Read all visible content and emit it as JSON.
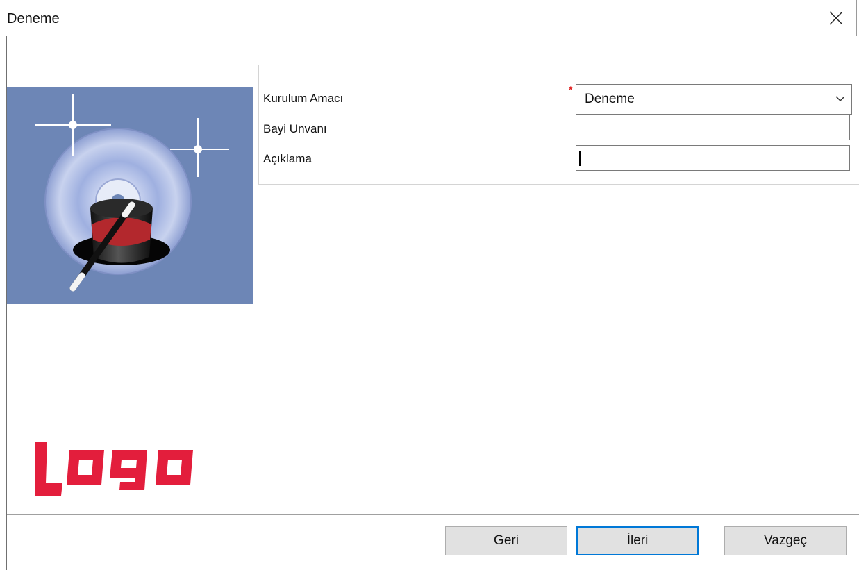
{
  "window": {
    "title": "Deneme",
    "close_icon": "close-icon"
  },
  "side_panel": {
    "image_icon": "setup-wizard-cd-magic-hat-icon",
    "image_background": "#6d86b6",
    "logo_text": "logo",
    "logo_color": "#e31e3c"
  },
  "form": {
    "fields": [
      {
        "label": "Kurulum Amacı",
        "type": "select",
        "value": "Deneme",
        "required": true,
        "required_mark": "*"
      },
      {
        "label": "Bayi Unvanı",
        "type": "text",
        "value": ""
      },
      {
        "label": "Açıklama",
        "type": "text",
        "value": ""
      }
    ]
  },
  "buttons": {
    "back": "Geri",
    "next": "İleri",
    "cancel": "Vazgeç"
  },
  "colors": {
    "accent": "#0078d7",
    "required": "#e02020"
  }
}
